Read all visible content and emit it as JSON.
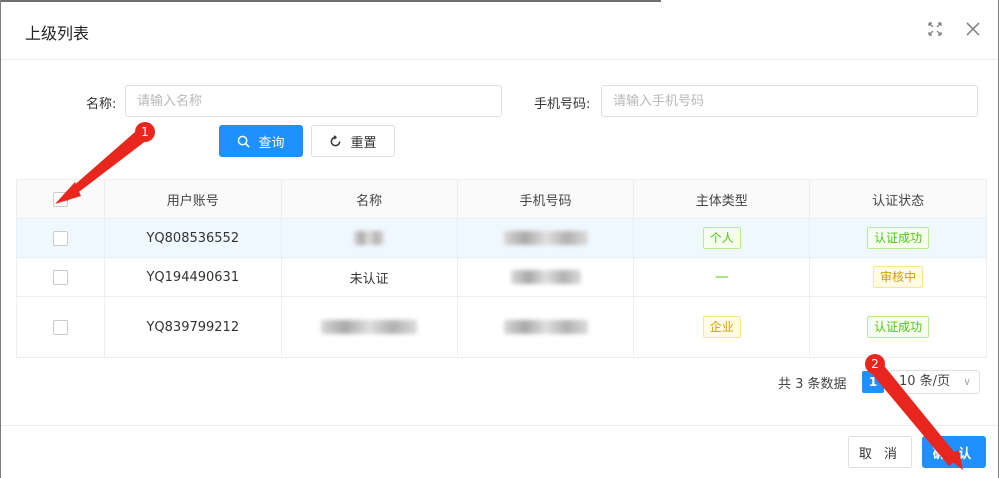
{
  "dialog": {
    "title": "上级列表",
    "expand_icon": "expand-icon",
    "close_icon": "close-icon"
  },
  "search": {
    "name_label": "名称:",
    "name_placeholder": "请输入名称",
    "phone_label": "手机号码:",
    "phone_placeholder": "请输入手机号码",
    "search_button": "查询",
    "reset_button": "重置"
  },
  "table": {
    "columns": [
      "用户账号",
      "名称",
      "手机号码",
      "主体类型",
      "认证状态"
    ],
    "rows": [
      {
        "account": "YQ808536552",
        "name": "",
        "phone": "",
        "type": "个人",
        "status": "认证成功"
      },
      {
        "account": "YQ194490631",
        "name": "未认证",
        "phone": "",
        "type": "—",
        "status": "审核中"
      },
      {
        "account": "YQ839799212",
        "name": "",
        "phone": "",
        "type": "企业",
        "status": "认证成功"
      }
    ]
  },
  "pagination": {
    "total_text": "共 3 条数据",
    "current_page": "1",
    "page_size": "10 条/页"
  },
  "footer": {
    "cancel": "取 消",
    "ok": "确 认"
  },
  "annotations": {
    "marker1": "1",
    "marker2": "2"
  },
  "colors": {
    "primary": "#1e90ff",
    "success_tag": "#52c41a",
    "warning_tag": "#d4a000",
    "danger_text": "#e8261e"
  }
}
